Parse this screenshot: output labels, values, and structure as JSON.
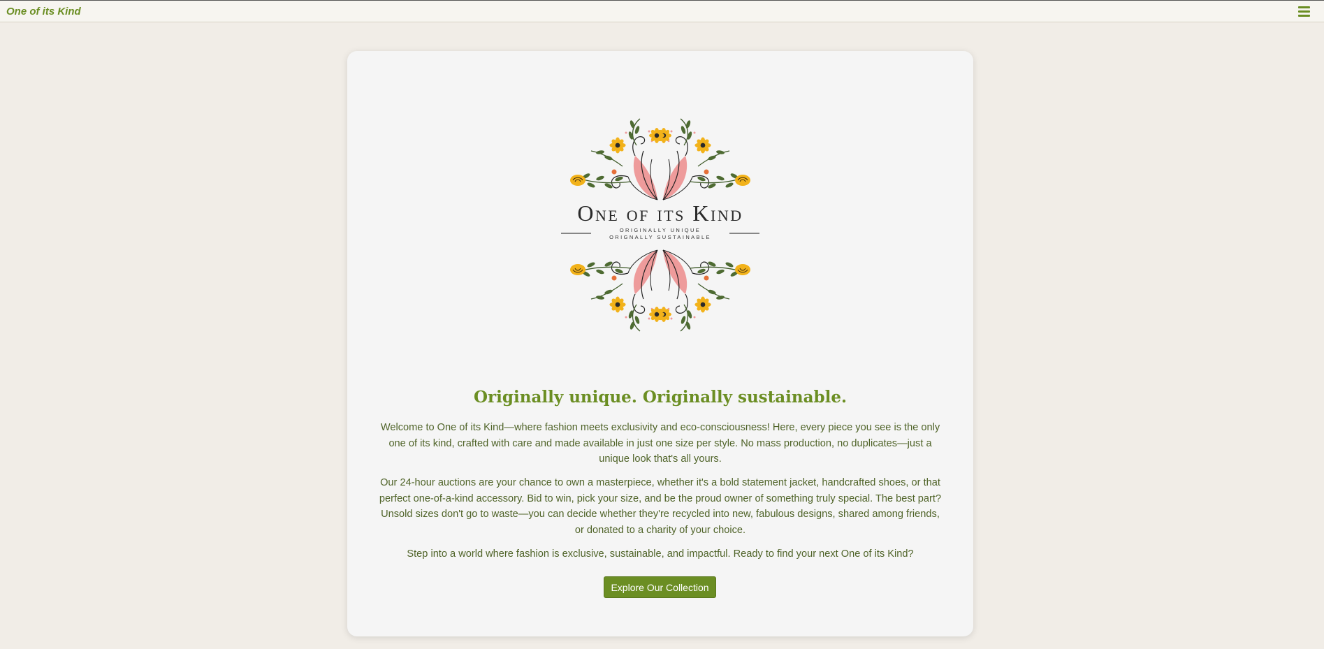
{
  "header": {
    "brand": "One of its Kind",
    "menu_icon": "hamburger-menu-icon"
  },
  "logo": {
    "wordmark": "One of its Kind",
    "tagline_line1": "ORIGINALLY UNIQUE",
    "tagline_line2": "ORIGNALLY SUSTAINABLE"
  },
  "hero": {
    "headline": "Originally unique. Originally sustainable.",
    "paragraphs": [
      "Welcome to One of its Kind—where fashion meets exclusivity and eco-consciousness! Here, every piece you see is the only one of its kind, crafted with care and made available in just one size per style. No mass production, no duplicates—just a unique look that's all yours.",
      "Our 24-hour auctions are your chance to own a masterpiece, whether it's a bold statement jacket, handcrafted shoes, or that perfect one-of-a-kind accessory. Bid to win, pick your size, and be the proud owner of something truly special. The best part? Unsold sizes don't go to waste—you can decide whether they're recycled into new, fabulous designs, shared among friends, or donated to a charity of your choice.",
      "Step into a world where fashion is exclusive, sustainable, and impactful. Ready to find your next One of its Kind?"
    ],
    "cta_label": "Explore Our Collection"
  },
  "colors": {
    "accent": "#6b8e23",
    "background": "#f1ede7",
    "card": "#f5f5f5",
    "body_text": "#4f6328"
  }
}
